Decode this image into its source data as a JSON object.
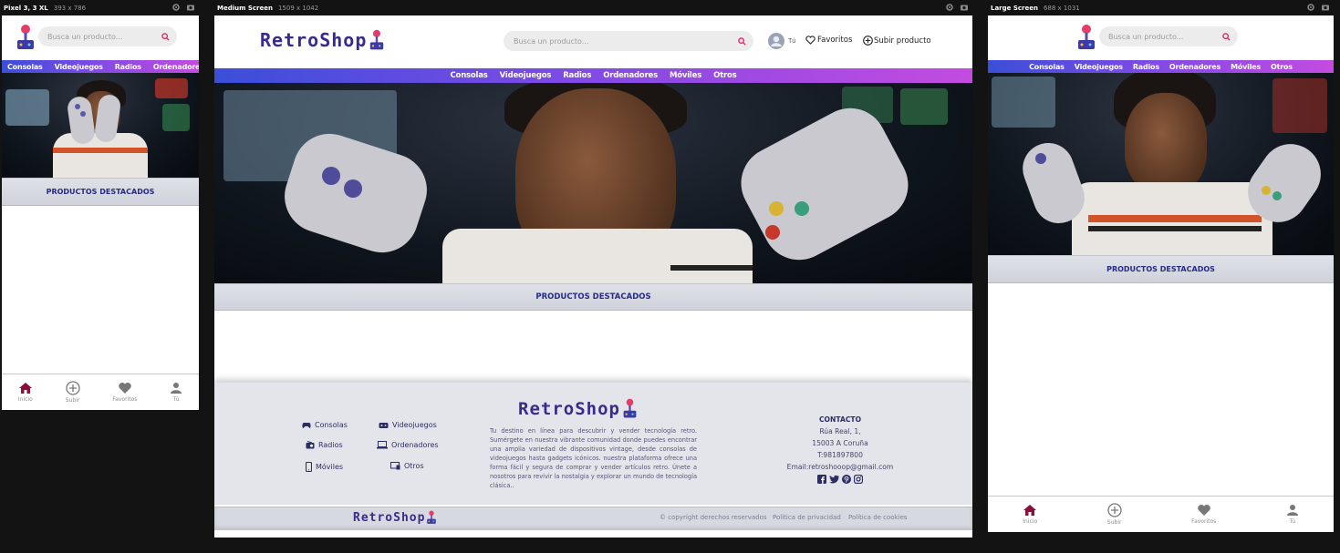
{
  "frames": {
    "small": {
      "name": "Pixel 3, 3 XL",
      "size": "393 x 786"
    },
    "medium": {
      "name": "Medium Screen",
      "size": "1509 x 1042"
    },
    "large": {
      "name": "Large Screen",
      "size": "688 x 1031"
    }
  },
  "brand": "RetroShop",
  "search": {
    "placeholder": "Busca un producto..."
  },
  "header_actions": {
    "user": "Tú",
    "favorites": "Favoritos",
    "upload": "Subir producto"
  },
  "categories": [
    "Consolas",
    "Videojuegos",
    "Radios",
    "Ordenadores",
    "Móviles",
    "Otros"
  ],
  "featured_title": "PRODUCTOS DESTACADOS",
  "bottom_nav": {
    "home": "Inicio",
    "upload": "Subir",
    "favorites": "Favoritos",
    "user": "Tú"
  },
  "footer": {
    "categories": {
      "consoles": "Consolas",
      "games": "Videojuegos",
      "radios": "Radios",
      "computers": "Ordenadores",
      "phones": "Móviles",
      "others": "Otros"
    },
    "description": "Tu destino en línea para descubrir y vender tecnología retro. Sumérgete en nuestra vibrante comunidad donde puedes encontrar una amplia variedad de dispositivos vintage, desde consolas de videojuegos hasta gadgets icónicos. nuestra plataforma ofrece una forma fácil y segura de comprar y vender artículos retro. Únete a nosotros para revivir la nostalgia y explorar un mundo de tecnología clásica..",
    "contact": {
      "title": "CONTACTO",
      "address1": "Rúa Real, 1,",
      "address2": "15003 A Coruña",
      "phone": "T:981897800",
      "email": "Email:retroshooop@gmail.com"
    },
    "copyright": "© copyright derechos reservados",
    "privacy": "Política de privacidad",
    "cookies": "Política de cookies"
  },
  "colors": {
    "accent_home": "#8a0f3a",
    "nav_start": "#3a4fd8",
    "nav_end": "#c44be0",
    "featured_text": "#272b84"
  }
}
